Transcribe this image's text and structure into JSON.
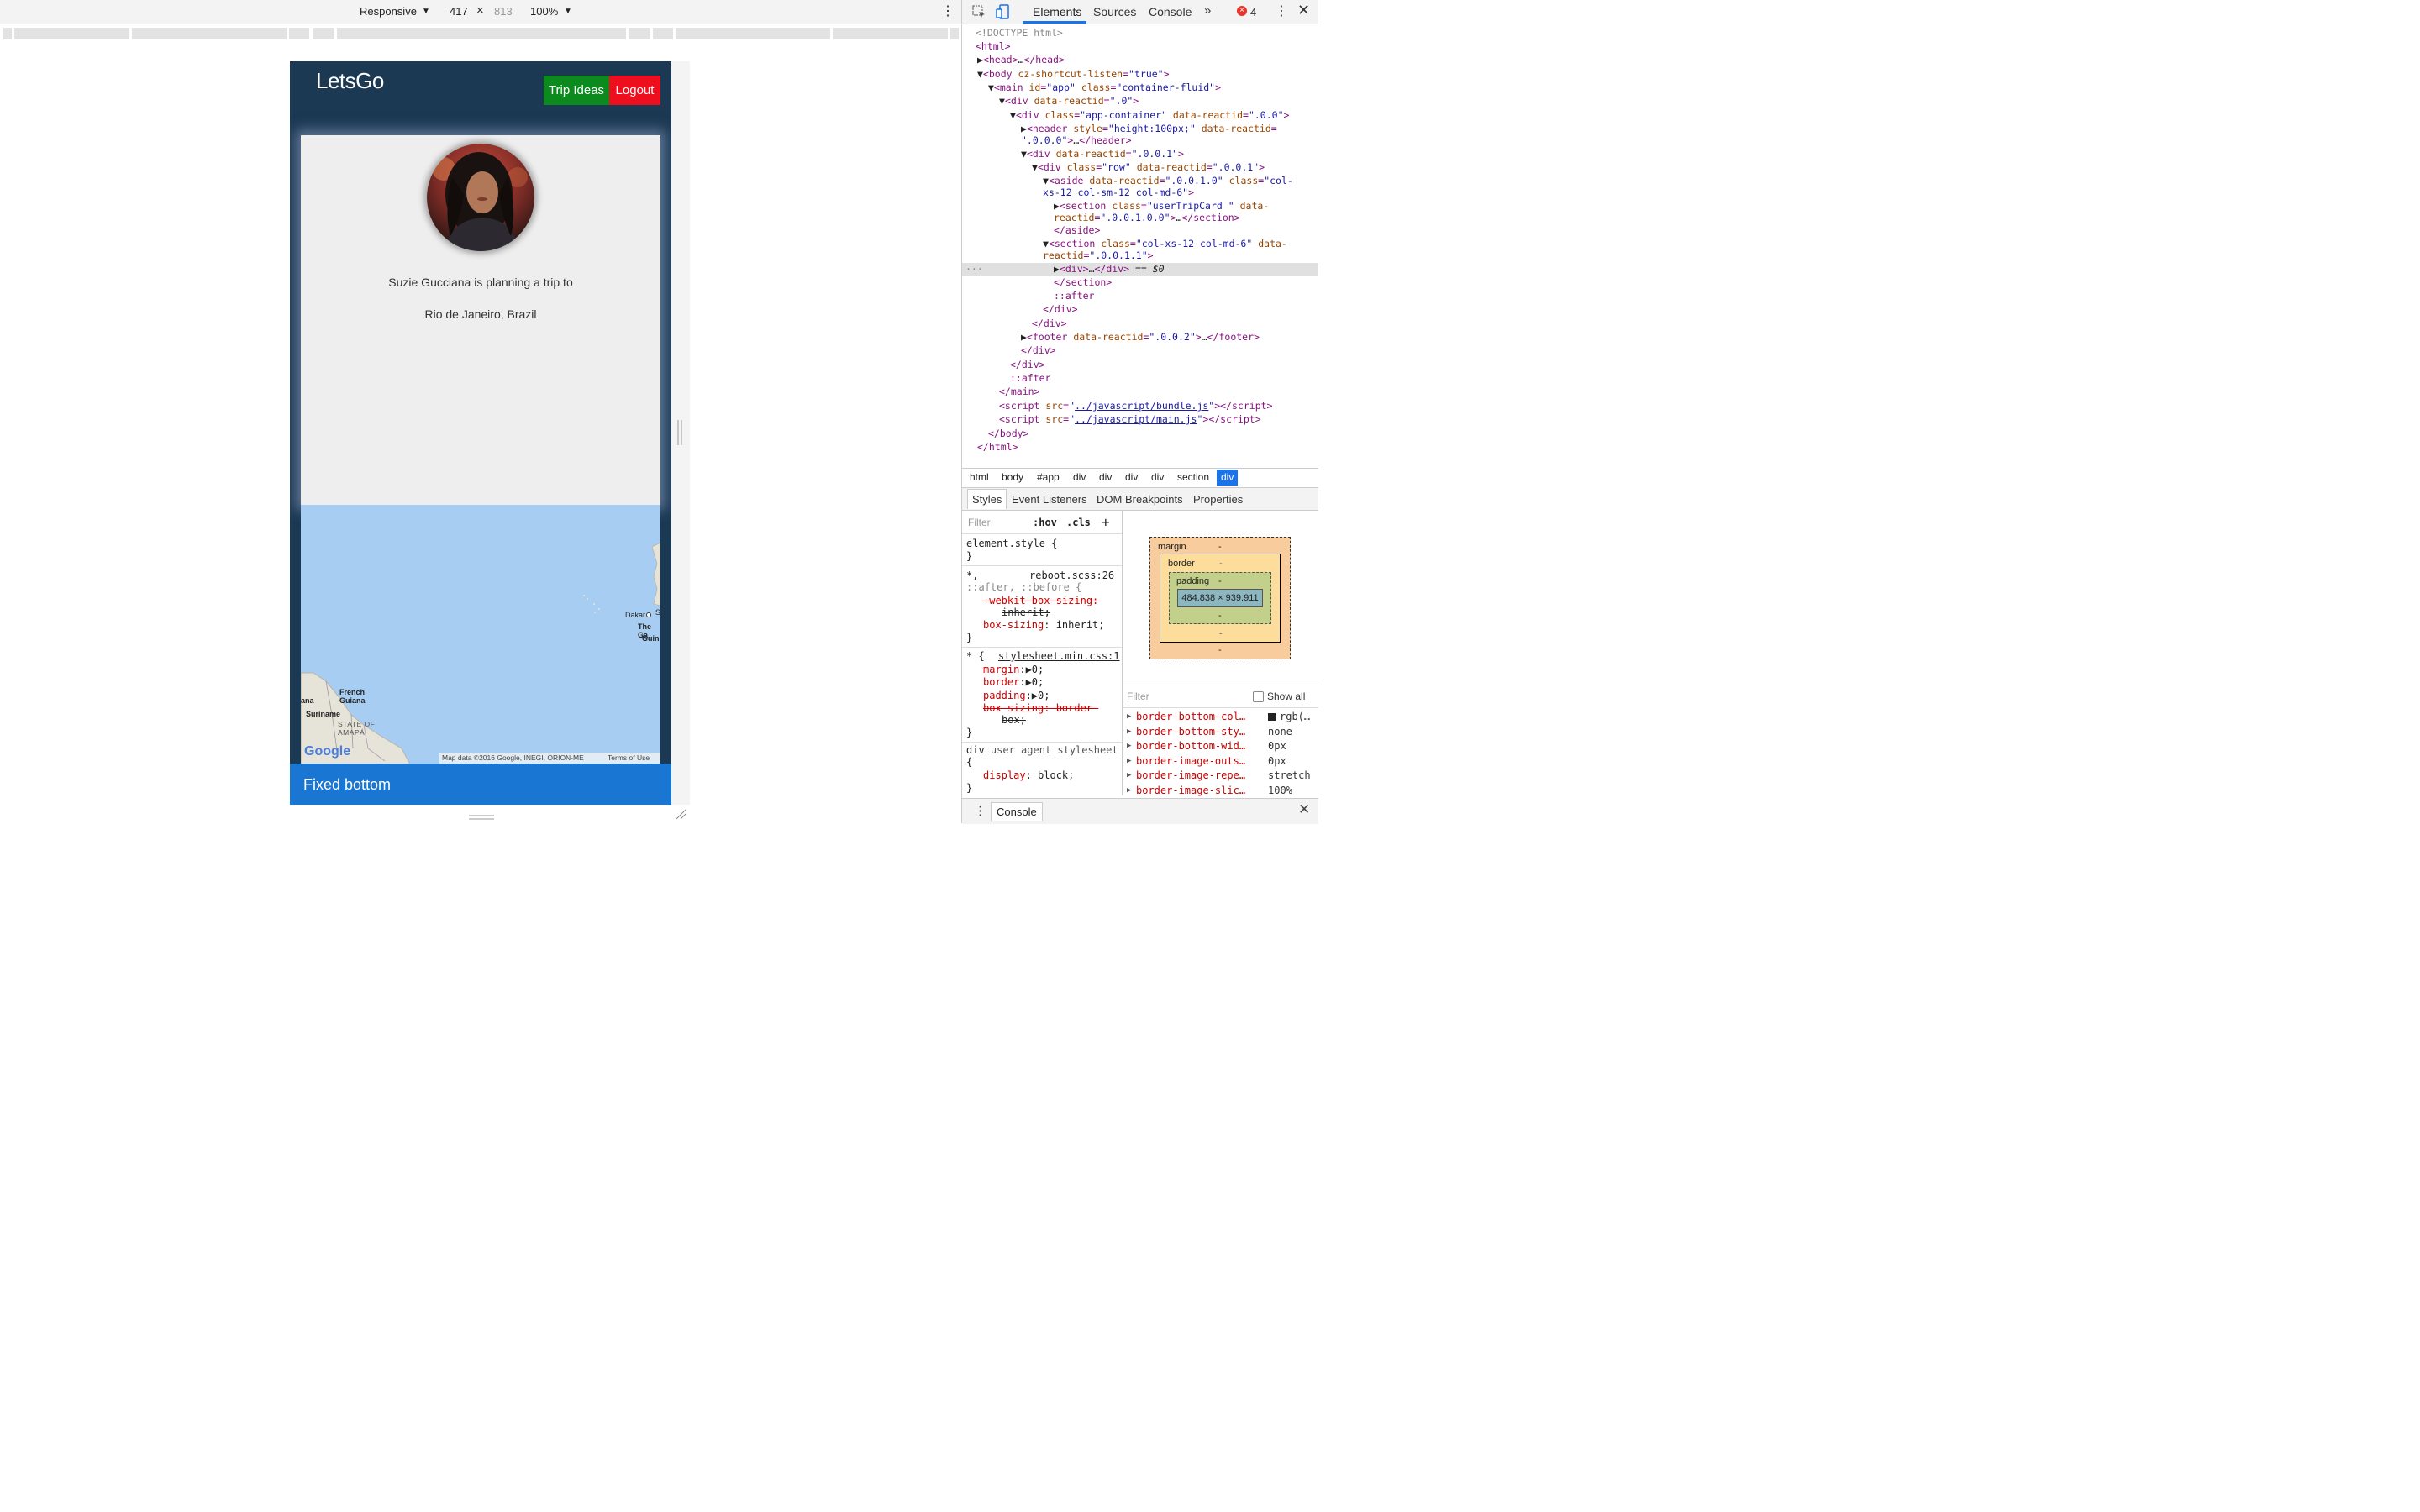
{
  "device_toolbar": {
    "mode": "Responsive",
    "width": "417",
    "times": "×",
    "height": "813",
    "zoom": "100%"
  },
  "app": {
    "brand": "LetsGo",
    "nav": [
      "Trip Ideas",
      "Logout"
    ],
    "trip_text": "Suzie Gucciana is planning a trip to",
    "destination": "Rio de Janeiro, Brazil",
    "footer": "Fixed bottom",
    "map": {
      "labels": [
        "Dakar",
        "The Ga",
        "Guin",
        "French Guiana",
        "Suriname",
        "ana",
        "STATE OF AMAPÁ",
        "S"
      ],
      "attribution": "Map data ©2016 Google, INEGI, ORION-ME",
      "terms": "Terms of Use",
      "logo": "Google"
    }
  },
  "devtools": {
    "tabs": [
      "Elements",
      "Sources",
      "Console"
    ],
    "error_count": "4",
    "breadcrumbs": [
      "html",
      "body",
      "#app",
      "div",
      "div",
      "div",
      "div",
      "section",
      "div"
    ],
    "sub_tabs": [
      "Styles",
      "Event Listeners",
      "DOM Breakpoints",
      "Properties"
    ],
    "filter_placeholder": "Filter",
    "hov": ":hov",
    "cls": ".cls",
    "box_model": {
      "margin": "margin",
      "border": "border",
      "padding": "padding",
      "content": "484.838 × 939.911",
      "dash": "-"
    },
    "computed_filter": "Filter",
    "show_all": "Show all",
    "computed": [
      [
        "border-bottom-col…",
        "rgb(…"
      ],
      [
        "border-bottom-sty…",
        "none"
      ],
      [
        "border-bottom-wid…",
        "0px"
      ],
      [
        "border-image-outs…",
        "0px"
      ],
      [
        "border-image-repe…",
        "stretch"
      ],
      [
        "border-image-slic…",
        "100%"
      ]
    ],
    "console_tab": "Console"
  }
}
